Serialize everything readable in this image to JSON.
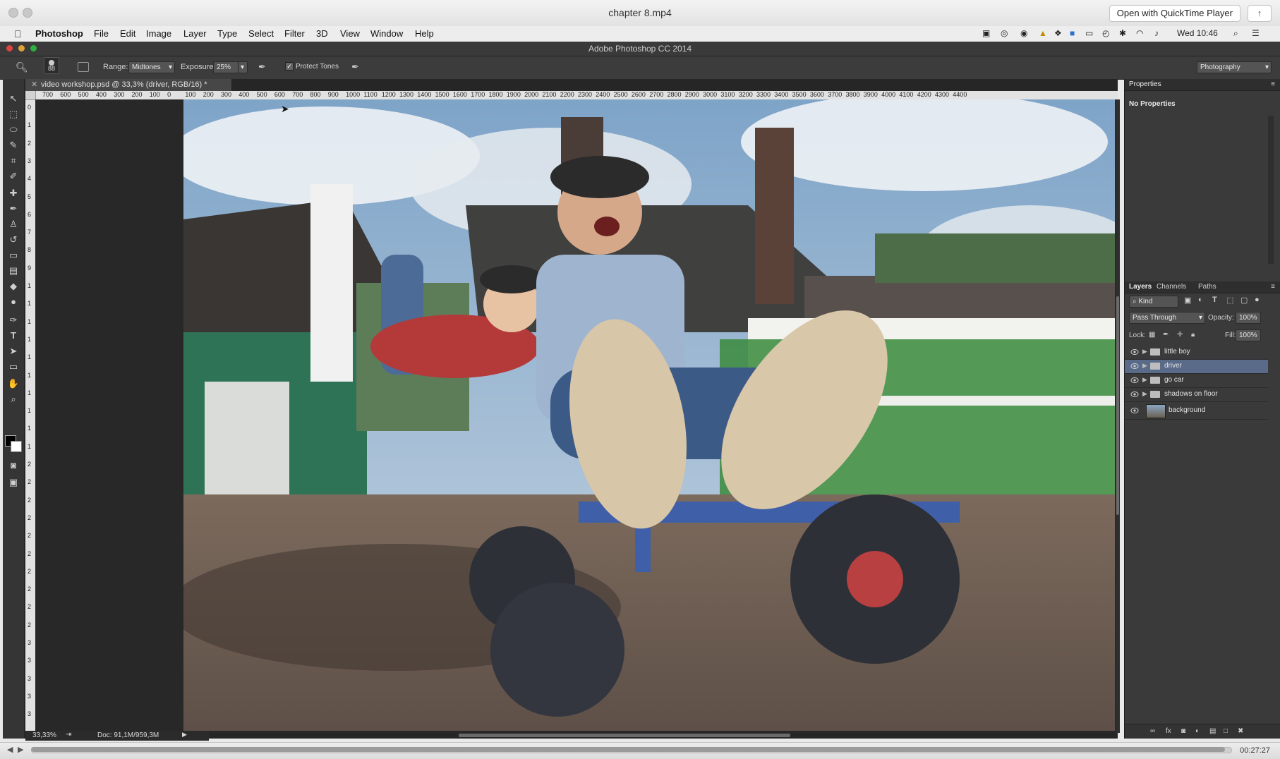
{
  "qt": {
    "title": "chapter 8.mp4",
    "open_button": "Open with QuickTime Player",
    "share_icon": "share-icon",
    "time": "00:27:27",
    "progress": 0.995
  },
  "menubar": {
    "app": "Photoshop",
    "items": [
      "File",
      "Edit",
      "Image",
      "Layer",
      "Type",
      "Select",
      "Filter",
      "3D",
      "View",
      "Window",
      "Help"
    ],
    "clock": "Wed 10:46"
  },
  "ps": {
    "title": "Adobe Photoshop CC 2014",
    "workspace": "Photography",
    "options": {
      "brush_size": "88",
      "range_label": "Range:",
      "range_value": "Midtones",
      "exposure_label": "Exposure:",
      "exposure_value": "25%",
      "protect_tones": "Protect Tones"
    },
    "document": {
      "tab": "video workshop.psd @ 33,3% (driver, RGB/16) *",
      "zoom": "33,33%",
      "doc_info": "Doc: 91,1M/959,3M",
      "ruler_ticks": [
        "700",
        "600",
        "500",
        "400",
        "300",
        "200",
        "100",
        "0",
        "100",
        "200",
        "300",
        "400",
        "500",
        "600",
        "700",
        "800",
        "900",
        "1000",
        "1100",
        "1200",
        "1300",
        "1400",
        "1500",
        "1600",
        "1700",
        "1800",
        "1900",
        "2000",
        "2100",
        "2200",
        "2300",
        "2400",
        "2500",
        "2600",
        "2700",
        "2800",
        "2900",
        "3000",
        "3100",
        "3200",
        "3300",
        "3400",
        "3500",
        "3600",
        "3700",
        "3800",
        "3900",
        "4000",
        "4100",
        "4200",
        "4300",
        "4400"
      ],
      "vruler_ticks": [
        "0",
        "1",
        "2",
        "3",
        "4",
        "5",
        "6",
        "7",
        "8",
        "9",
        "1",
        "1",
        "1",
        "1",
        "1",
        "1",
        "1",
        "1",
        "1",
        "1",
        "2",
        "2",
        "2",
        "2",
        "2",
        "2",
        "2",
        "2",
        "2",
        "2",
        "3",
        "3",
        "3",
        "3",
        "3"
      ]
    },
    "properties": {
      "tab": "Properties",
      "content": "No Properties"
    },
    "layers_panel": {
      "tabs": [
        "Layers",
        "Channels",
        "Paths"
      ],
      "filter": "Kind",
      "blend_mode": "Pass Through",
      "opacity_label": "Opacity:",
      "opacity_value": "100%",
      "lock_label": "Lock:",
      "fill_label": "Fill:",
      "fill_value": "100%",
      "layers": [
        {
          "name": "little boy",
          "type": "group",
          "selected": false
        },
        {
          "name": "driver",
          "type": "group",
          "selected": true
        },
        {
          "name": "go car",
          "type": "group",
          "selected": false
        },
        {
          "name": "shadows on floor",
          "type": "group",
          "selected": false
        },
        {
          "name": "background",
          "type": "image",
          "selected": false
        }
      ]
    },
    "tools": [
      "move-tool-icon",
      "marquee-tool-icon",
      "lasso-tool-icon",
      "quick-select-tool-icon",
      "crop-tool-icon",
      "eyedropper-tool-icon",
      "healing-brush-icon",
      "brush-tool-icon",
      "clone-stamp-icon",
      "history-brush-icon",
      "eraser-tool-icon",
      "gradient-tool-icon",
      "blur-tool-icon",
      "dodge-tool-icon",
      "pen-tool-icon",
      "type-tool-icon",
      "path-select-icon",
      "shape-tool-icon",
      "hand-tool-icon",
      "zoom-tool-icon"
    ]
  }
}
